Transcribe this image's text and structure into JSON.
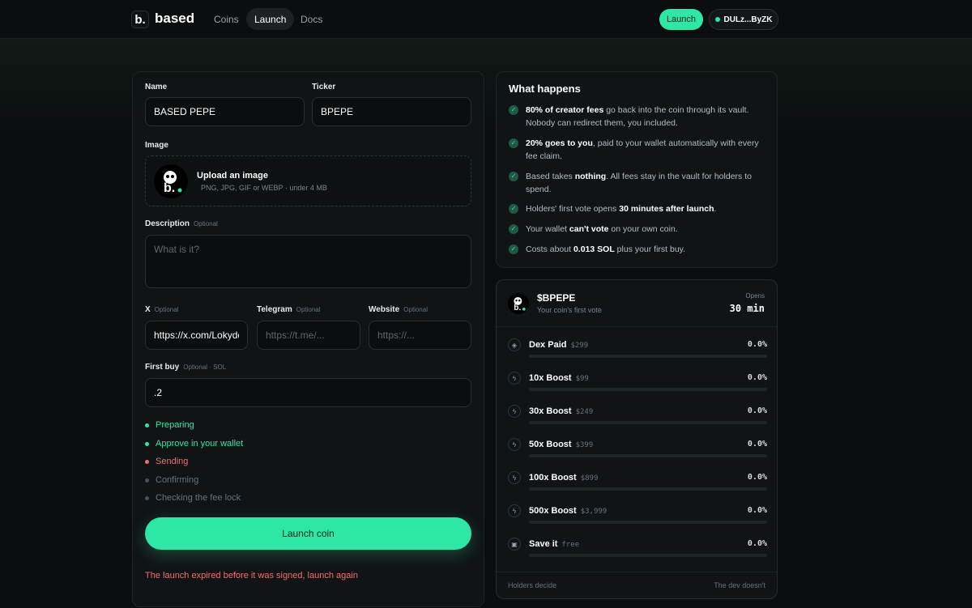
{
  "nav": {
    "brand": "based",
    "logo_letter": "b.",
    "links": [
      {
        "label": "Coins"
      },
      {
        "label": "Launch"
      },
      {
        "label": "Docs"
      }
    ],
    "launch_label": "Launch",
    "wallet_label": "DULz...ByZK"
  },
  "form": {
    "name_label": "Name",
    "name_value": "BASED PEPE",
    "ticker_label": "Ticker",
    "ticker_value": "BPEPE",
    "image_label": "Image",
    "upload_title": "Upload an image",
    "upload_sub": "PNG, JPG, GIF or WEBP · under 4 MB",
    "description_label": "Description",
    "optional": "Optional",
    "description_placeholder": "What is it?",
    "x_label": "X",
    "x_value": "https://x.com/Lokyde",
    "telegram_label": "Telegram",
    "telegram_placeholder": "https://t.me/...",
    "website_label": "Website",
    "website_placeholder": "https://...",
    "first_buy_label": "First buy",
    "first_buy_hint": "Optional · SOL",
    "first_buy_value": ".2",
    "steps": [
      {
        "label": "Preparing",
        "status": "done"
      },
      {
        "label": "Approve in your wallet",
        "status": "done"
      },
      {
        "label": "Sending",
        "status": "error"
      },
      {
        "label": "Confirming",
        "status": "pending"
      },
      {
        "label": "Checking the fee lock",
        "status": "pending"
      }
    ],
    "launch_button": "Launch coin",
    "error": "The launch expired before it was signed, launch again"
  },
  "what": {
    "title": "What happens",
    "bullets": [
      {
        "bold": "80% of creator fees",
        "text": " go back into the coin through its vault. Nobody can redirect them, you included."
      },
      {
        "bold": "20% goes to you",
        "text": ", paid to your wallet automatically with every fee claim."
      },
      {
        "pre": "Based takes ",
        "bold": "nothing",
        "text": ". All fees stay in the vault for holders to spend."
      },
      {
        "pre": "Holders' first vote opens ",
        "bold": "30 minutes after launch",
        "text": "."
      },
      {
        "pre": "Your wallet ",
        "bold": "can't vote",
        "text": " on your own coin."
      },
      {
        "pre": "Costs about ",
        "bold": "0.013 SOL",
        "text": " plus your first buy."
      }
    ]
  },
  "vote": {
    "ticker": "$BPEPE",
    "subtitle": "Your coin's first vote",
    "opens_label": "Opens",
    "opens_value": "30 min",
    "options": [
      {
        "name": "Dex Paid",
        "price": "$299",
        "pct": "0.0%",
        "fraction": 0,
        "icon": "shield-icon"
      },
      {
        "name": "10x Boost",
        "price": "$99",
        "pct": "0.0%",
        "fraction": 0,
        "icon": "bolt-icon"
      },
      {
        "name": "30x Boost",
        "price": "$249",
        "pct": "0.0%",
        "fraction": 0,
        "icon": "bolt-icon"
      },
      {
        "name": "50x Boost",
        "price": "$399",
        "pct": "0.0%",
        "fraction": 0,
        "icon": "bolt-icon"
      },
      {
        "name": "100x Boost",
        "price": "$899",
        "pct": "0.0%",
        "fraction": 0,
        "icon": "bolt-icon"
      },
      {
        "name": "500x Boost",
        "price": "$3,999",
        "pct": "0.0%",
        "fraction": 0,
        "icon": "bolt-icon"
      },
      {
        "name": "Save it",
        "price": "free",
        "pct": "0.0%",
        "fraction": 0,
        "icon": "briefcase-icon"
      }
    ],
    "footer_left": "Holders decide",
    "footer_right": "The dev doesn't"
  },
  "colors": {
    "accent": "#2ee6a6",
    "error": "#f0706a",
    "pending": "#4a5256"
  }
}
